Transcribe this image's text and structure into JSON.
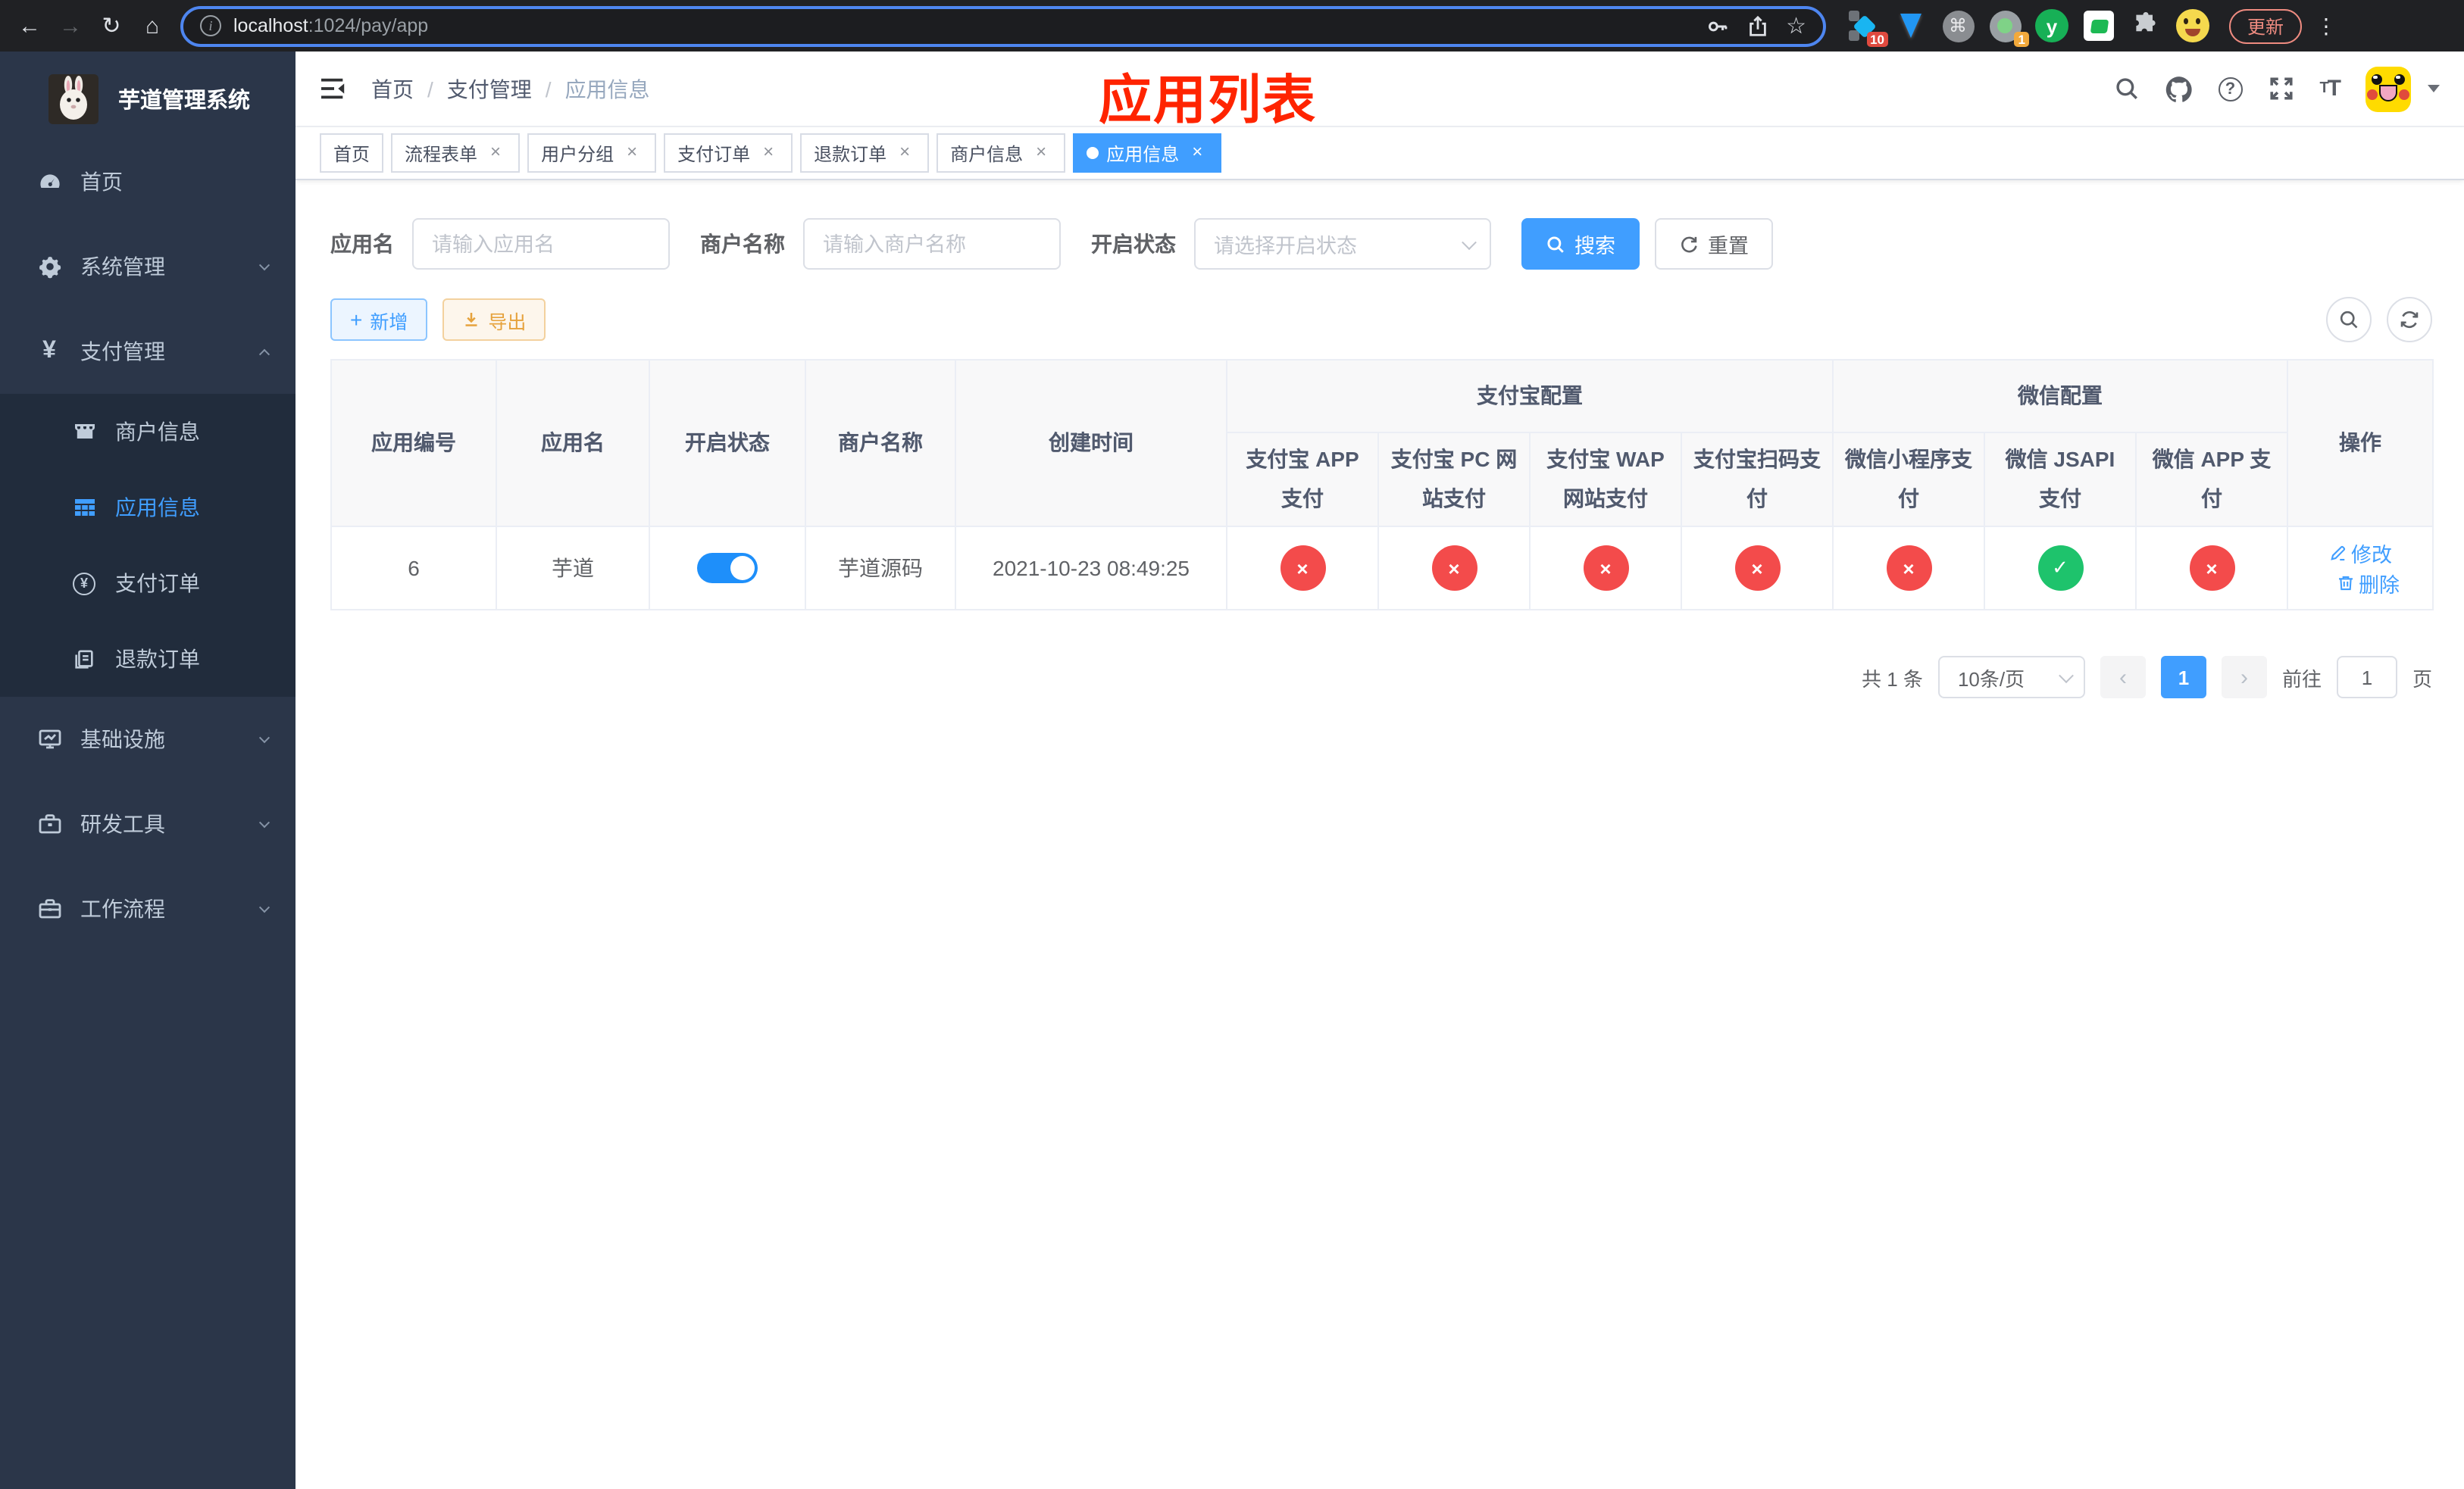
{
  "icons": {
    "back": "←",
    "forward": "→",
    "reload": "↻",
    "home": "⌂",
    "star": "☆",
    "command": "⌘",
    "dots": "⋮",
    "close": "×",
    "check": "✓",
    "cross": "×",
    "yen": "¥",
    "question": "?",
    "info": "i",
    "plus": "+",
    "prev": "‹",
    "next": "›",
    "big_t": "T",
    "small_t": "T"
  },
  "browser": {
    "url_host": "localhost",
    "url_rest": ":1024/pay/app",
    "update_label": "更新",
    "ext_badge_blue_diamond": "10",
    "ext_badge_camera": "1",
    "ext_letter_y": "y"
  },
  "sidebar": {
    "title": "芋道管理系统",
    "items": [
      {
        "label": "首页"
      },
      {
        "label": "系统管理"
      },
      {
        "label": "支付管理"
      },
      {
        "label": "基础设施"
      },
      {
        "label": "研发工具"
      },
      {
        "label": "工作流程"
      }
    ],
    "submenu": [
      {
        "label": "商户信息"
      },
      {
        "label": "应用信息"
      },
      {
        "label": "支付订单"
      },
      {
        "label": "退款订单"
      }
    ]
  },
  "header": {
    "breadcrumb": [
      "首页",
      "支付管理",
      "应用信息"
    ],
    "overlay_title": "应用列表"
  },
  "tabs": [
    "首页",
    "流程表单",
    "用户分组",
    "支付订单",
    "退款订单",
    "商户信息",
    "应用信息"
  ],
  "filters": {
    "app_name_label": "应用名",
    "app_name_placeholder": "请输入应用名",
    "merchant_label": "商户名称",
    "merchant_placeholder": "请输入商户名称",
    "status_label": "开启状态",
    "status_placeholder": "请选择开启状态",
    "search_label": "搜索",
    "reset_label": "重置"
  },
  "toolbar": {
    "add_label": "新增",
    "export_label": "导出"
  },
  "table": {
    "groups": {
      "alipay": "支付宝配置",
      "wechat": "微信配置"
    },
    "columns_left": [
      "应用编号",
      "应用名",
      "开启状态",
      "商户名称",
      "创建时间"
    ],
    "pay_columns": [
      "支付宝 APP 支付",
      "支付宝 PC 网站支付",
      "支付宝 WAP 网站支付",
      "支付宝扫码支付",
      "微信小程序支付",
      "微信 JSAPI 支付",
      "微信 APP 支付"
    ],
    "op_column": "操作",
    "row": {
      "id": "6",
      "name": "芋道",
      "status_on": true,
      "merchant": "芋道源码",
      "created": "2021-10-23 08:49:25",
      "pay_flags": [
        false,
        false,
        false,
        false,
        false,
        true,
        false
      ],
      "edit_label": "修改",
      "delete_label": "删除"
    }
  },
  "pagination": {
    "total": "共 1 条",
    "page_size": "10条/页",
    "page": "1",
    "goto": "前往",
    "goto_value": "1",
    "page_unit": "页"
  },
  "colors": {
    "accent": "#409eff",
    "danger": "#f34b4b",
    "success": "#1ec36c",
    "warning": "#e6a23c"
  }
}
